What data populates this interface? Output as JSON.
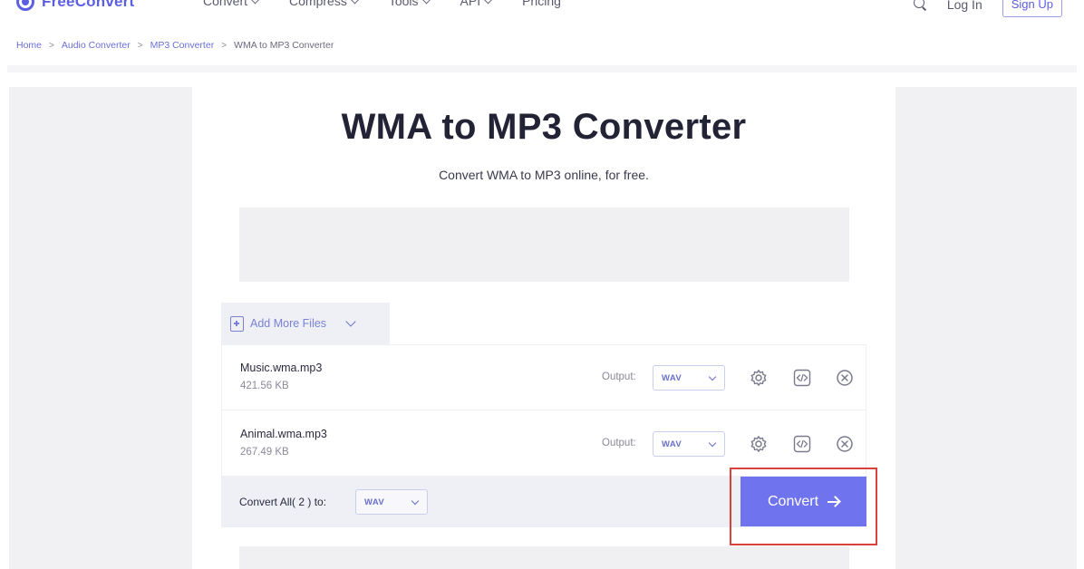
{
  "brand": {
    "name": "FreeConvert",
    "accent_color": "#5b5fe0"
  },
  "nav": {
    "items": [
      {
        "label": "Convert",
        "has_dropdown": true
      },
      {
        "label": "Compress",
        "has_dropdown": true
      },
      {
        "label": "Tools",
        "has_dropdown": true
      },
      {
        "label": "API",
        "has_dropdown": true
      },
      {
        "label": "Pricing",
        "has_dropdown": false
      }
    ],
    "login_label": "Log In",
    "signup_label": "Sign Up"
  },
  "breadcrumb": {
    "items": [
      "Home",
      "Audio Converter",
      "MP3 Converter"
    ],
    "current": "WMA to MP3 Converter",
    "separator": ">"
  },
  "main": {
    "title": "WMA to MP3 Converter",
    "subtitle": "Convert WMA to MP3 online, for free."
  },
  "upload": {
    "add_more_label": "Add More Files",
    "output_label": "Output:",
    "files": [
      {
        "name": "Music.wma.mp3",
        "size": "421.56 KB",
        "output_format": "WAV"
      },
      {
        "name": "Animal.wma.mp3",
        "size": "267.49 KB",
        "output_format": "WAV"
      }
    ],
    "convert_all_label": "Convert All( 2 ) to:",
    "convert_all_format": "WAV",
    "convert_button_label": "Convert",
    "button_color": "#6f74ee",
    "highlight_color": "#d9413a"
  }
}
